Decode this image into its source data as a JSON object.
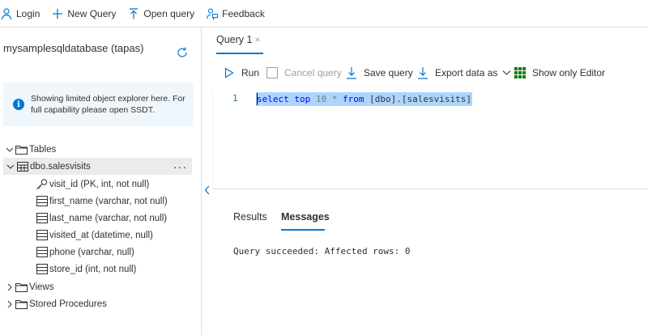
{
  "topbar": {
    "login_label": "Login",
    "new_query_label": "New Query",
    "open_query_label": "Open query",
    "feedback_label": "Feedback"
  },
  "left": {
    "database_title": "mysamplesqldatabase (tapas)",
    "info_text_line1": "Showing limited object explorer here. For",
    "info_text_line2": "full capability please open SSDT.",
    "tree": {
      "tables_label": "Tables",
      "table_name": "dbo.salesvisits",
      "more_label": "···",
      "columns": [
        {
          "label": "visit_id (PK, int, not null)",
          "key": true
        },
        {
          "label": "first_name (varchar, not null)",
          "key": false
        },
        {
          "label": "last_name (varchar, not null)",
          "key": false
        },
        {
          "label": "visited_at (datetime, null)",
          "key": false
        },
        {
          "label": "phone (varchar, null)",
          "key": false
        },
        {
          "label": "store_id (int, not null)",
          "key": false
        }
      ],
      "views_label": "Views",
      "procs_label": "Stored Procedures"
    }
  },
  "editor_tab": {
    "label": "Query 1",
    "close_glyph": "×"
  },
  "query_toolbar": {
    "run_label": "Run",
    "cancel_label": "Cancel query",
    "save_label": "Save query",
    "export_label": "Export data as",
    "show_editor_label": "Show only Editor"
  },
  "editor": {
    "line_number": "1",
    "tokens": {
      "select": "select",
      "top": "top",
      "ten": "10",
      "star": "*",
      "from": "from",
      "table": "[dbo].[salesvisits]"
    }
  },
  "results": {
    "results_tab": "Results",
    "messages_tab": "Messages",
    "message_text": "Query succeeded: Affected rows: 0"
  },
  "colors": {
    "accent": "#0078d4",
    "selection": "#add6ff",
    "keyword": "#0000ff",
    "info_bg": "#eff6fc"
  }
}
